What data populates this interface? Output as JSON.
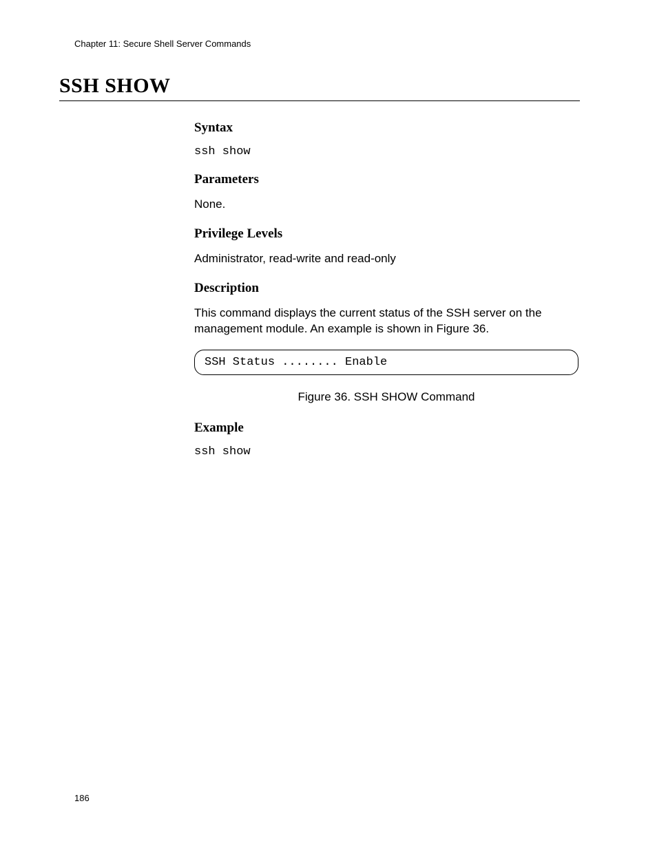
{
  "header": {
    "chapter": "Chapter 11: Secure Shell Server Commands"
  },
  "title": "SSH SHOW",
  "sections": {
    "syntax": {
      "heading": "Syntax",
      "code": "ssh show"
    },
    "parameters": {
      "heading": "Parameters",
      "text": "None."
    },
    "privilege": {
      "heading": "Privilege Levels",
      "text": "Administrator, read-write and read-only"
    },
    "description": {
      "heading": "Description",
      "text": "This command displays the current status of the SSH server on the management module. An example is shown in Figure 36."
    },
    "figure": {
      "content": "SSH Status ........ Enable",
      "caption": "Figure 36. SSH SHOW Command"
    },
    "example": {
      "heading": "Example",
      "code": "ssh show"
    }
  },
  "pageNumber": "186"
}
